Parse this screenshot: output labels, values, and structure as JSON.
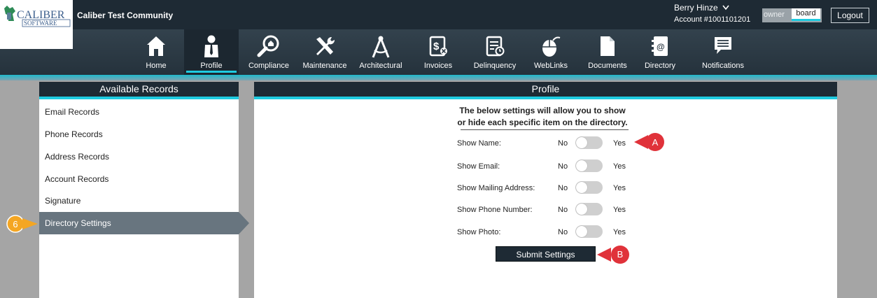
{
  "header": {
    "logo_text_top": "CALIBER",
    "logo_text_bottom": "SOFTWARE",
    "community": "Caliber Test Community",
    "user_name": "Berry Hinze",
    "account": "Account #1001101201",
    "roles": [
      "owner",
      "board"
    ],
    "logout_label": "Logout"
  },
  "nav": {
    "items": [
      {
        "label": "Home",
        "icon": "home-icon"
      },
      {
        "label": "Profile",
        "icon": "profile-icon",
        "active": true
      },
      {
        "label": "Compliance",
        "icon": "compliance-icon"
      },
      {
        "label": "Maintenance",
        "icon": "maintenance-icon"
      },
      {
        "label": "Architectural",
        "icon": "architectural-icon"
      },
      {
        "label": "Invoices",
        "icon": "invoices-icon"
      },
      {
        "label": "Delinquency",
        "icon": "delinquency-icon"
      },
      {
        "label": "WebLinks",
        "icon": "weblinks-icon"
      },
      {
        "label": "Documents",
        "icon": "documents-icon"
      },
      {
        "label": "Directory",
        "icon": "directory-icon"
      },
      {
        "label": "Notifications",
        "icon": "notifications-icon"
      }
    ]
  },
  "sidebar": {
    "title": "Available Records",
    "items": [
      {
        "label": "Email Records"
      },
      {
        "label": "Phone Records"
      },
      {
        "label": "Address Records"
      },
      {
        "label": "Account Records"
      },
      {
        "label": "Signature"
      },
      {
        "label": "Directory Settings",
        "active": true
      }
    ]
  },
  "profile": {
    "title": "Profile",
    "intro_line1": "The below settings will allow you to show",
    "intro_line2": "or hide each specific item on the directory.",
    "no_label": "No",
    "yes_label": "Yes",
    "settings": [
      {
        "label": "Show Name:",
        "value": "No"
      },
      {
        "label": "Show Email:",
        "value": "No"
      },
      {
        "label": "Show Mailing Address:",
        "value": "No"
      },
      {
        "label": "Show Phone Number:",
        "value": "No"
      },
      {
        "label": "Show Photo:",
        "value": "No"
      }
    ],
    "submit_label": "Submit Settings"
  },
  "callouts": {
    "a": "A",
    "b": "B",
    "step": "6"
  },
  "colors": {
    "header_dark": "#1e2a34",
    "accent": "#1ecbe0",
    "sidebar_active": "#68757f",
    "background_gray": "#a5a5a5",
    "callout_red": "#e0323a",
    "callout_orange": "#f4a623"
  }
}
